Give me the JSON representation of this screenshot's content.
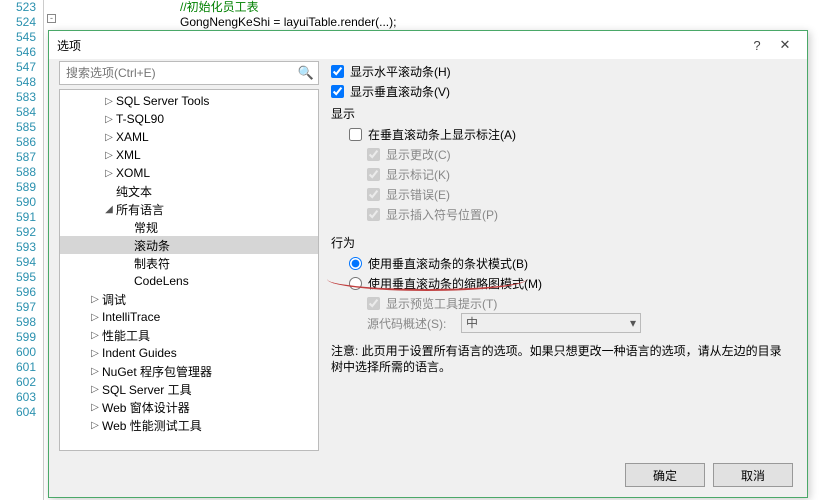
{
  "bg": {
    "lines": [
      "523",
      "524",
      "545",
      "546",
      "547",
      "548",
      "583",
      "584",
      "585",
      "586",
      "587",
      "588",
      "589",
      "590",
      "591",
      "592",
      "593",
      "594",
      "595",
      "596",
      "597",
      "598",
      "599",
      "600",
      "601",
      "602",
      "603",
      "604"
    ],
    "comment": "//初始化员工表",
    "code": "GongNengKeShi = layuiTable.render(...);"
  },
  "dialog": {
    "title": "选项",
    "help": "?",
    "close": "✕",
    "search_placeholder": "搜索选项(Ctrl+E)",
    "tree": [
      {
        "pad": 42,
        "arr": "▷",
        "label": "SQL Server Tools"
      },
      {
        "pad": 42,
        "arr": "▷",
        "label": "T-SQL90"
      },
      {
        "pad": 42,
        "arr": "▷",
        "label": "XAML"
      },
      {
        "pad": 42,
        "arr": "▷",
        "label": "XML"
      },
      {
        "pad": 42,
        "arr": "▷",
        "label": "XOML"
      },
      {
        "pad": 42,
        "arr": "",
        "label": "纯文本"
      },
      {
        "pad": 42,
        "arr": "◢",
        "label": "所有语言"
      },
      {
        "pad": 60,
        "arr": "",
        "label": "常规"
      },
      {
        "pad": 60,
        "arr": "",
        "label": "滚动条",
        "sel": true
      },
      {
        "pad": 60,
        "arr": "",
        "label": "制表符"
      },
      {
        "pad": 60,
        "arr": "",
        "label": "CodeLens"
      },
      {
        "pad": 28,
        "arr": "▷",
        "label": "调试"
      },
      {
        "pad": 28,
        "arr": "▷",
        "label": "IntelliTrace"
      },
      {
        "pad": 28,
        "arr": "▷",
        "label": "性能工具"
      },
      {
        "pad": 28,
        "arr": "▷",
        "label": "Indent Guides"
      },
      {
        "pad": 28,
        "arr": "▷",
        "label": "NuGet 程序包管理器"
      },
      {
        "pad": 28,
        "arr": "▷",
        "label": "SQL Server 工具"
      },
      {
        "pad": 28,
        "arr": "▷",
        "label": "Web 窗体设计器"
      },
      {
        "pad": 28,
        "arr": "▷",
        "label": "Web 性能测试工具"
      }
    ],
    "opts": {
      "h_scroll": "显示水平滚动条(H)",
      "v_scroll": "显示垂直滚动条(V)",
      "group_display": "显示",
      "annot": "在垂直滚动条上显示标注(A)",
      "changes": "显示更改(C)",
      "marks": "显示标记(K)",
      "errors": "显示错误(E)",
      "caret": "显示插入符号位置(P)",
      "group_behavior": "行为",
      "bar_mode": "使用垂直滚动条的条状模式(B)",
      "map_mode": "使用垂直滚动条的缩略图模式(M)",
      "preview": "显示预览工具提示(T)",
      "overview_label": "源代码概述(S):",
      "overview_value": "中",
      "note": "注意: 此页用于设置所有语言的选项。如果只想更改一种语言的选项，请从左边的目录树中选择所需的语言。"
    },
    "ok": "确定",
    "cancel": "取消"
  }
}
